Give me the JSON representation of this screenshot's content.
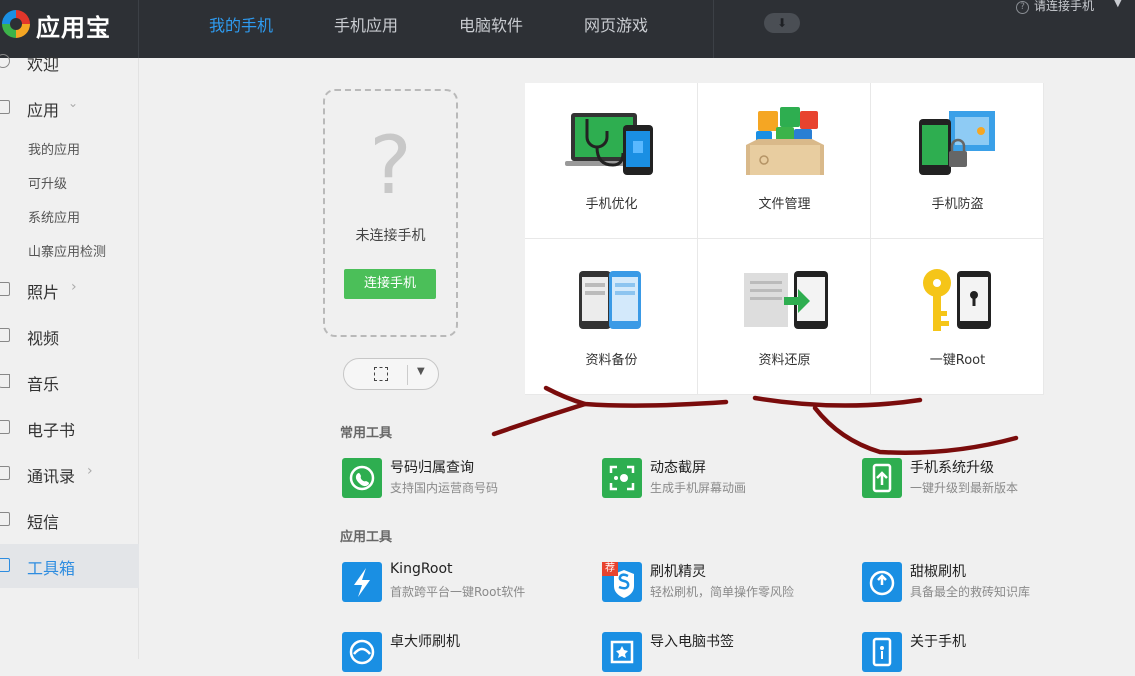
{
  "app": {
    "name": "应用宝"
  },
  "nav": {
    "tabs": [
      {
        "label": "我的手机",
        "active": true
      },
      {
        "label": "手机应用",
        "active": false
      },
      {
        "label": "电脑软件",
        "active": false
      },
      {
        "label": "网页游戏",
        "active": false
      }
    ],
    "download_icon": "download-icon",
    "connect_status": "请连接手机",
    "help_icon": "help-icon"
  },
  "sidebar": {
    "items": [
      {
        "label": "欢迎",
        "icon": "welcome-icon"
      },
      {
        "label": "应用",
        "icon": "grid-icon",
        "expanded": true
      },
      {
        "label": "照片",
        "icon": "photo-icon"
      },
      {
        "label": "视频",
        "icon": "video-icon"
      },
      {
        "label": "音乐",
        "icon": "music-icon"
      },
      {
        "label": "电子书",
        "icon": "book-icon"
      },
      {
        "label": "通讯录",
        "icon": "contacts-icon"
      },
      {
        "label": "短信",
        "icon": "sms-icon"
      },
      {
        "label": "工具箱",
        "icon": "toolbox-icon",
        "active": true
      }
    ],
    "sub_items": [
      "我的应用",
      "可升级",
      "系统应用",
      "山寨应用检测"
    ]
  },
  "phone_card": {
    "status": "未连接手机",
    "connect_button": "连接手机"
  },
  "feature_grid": [
    {
      "label": "手机优化",
      "icon": "phone-optimize-icon"
    },
    {
      "label": "文件管理",
      "icon": "file-manage-icon"
    },
    {
      "label": "手机防盗",
      "icon": "anti-theft-icon"
    },
    {
      "label": "资料备份",
      "icon": "backup-icon"
    },
    {
      "label": "资料还原",
      "icon": "restore-icon"
    },
    {
      "label": "一键Root",
      "icon": "root-key-icon"
    }
  ],
  "common_tools": {
    "title": "常用工具",
    "items": [
      {
        "name": "号码归属查询",
        "desc": "支持国内运营商号码",
        "icon": "phone-lookup-icon",
        "color": "#2eae50"
      },
      {
        "name": "动态截屏",
        "desc": "生成手机屏幕动画",
        "icon": "screen-capture-icon",
        "color": "#2eae50"
      },
      {
        "name": "手机系统升级",
        "desc": "一键升级到最新版本",
        "icon": "system-upgrade-icon",
        "color": "#2eae50"
      }
    ]
  },
  "app_tools": {
    "title": "应用工具",
    "items": [
      {
        "name": "KingRoot",
        "desc": "首款跨平台一键Root软件",
        "icon": "kingroot-icon",
        "color": "#1a8fe3"
      },
      {
        "name": "刷机精灵",
        "desc": "轻松刷机，简单操作零风险",
        "icon": "flash-wizard-icon",
        "color": "#1a8fe3",
        "badge": "荐"
      },
      {
        "name": "甜椒刷机",
        "desc": "具备最全的救砖知识库",
        "icon": "pepper-flash-icon",
        "color": "#1a8fe3"
      },
      {
        "name": "卓大师刷机",
        "desc": "",
        "icon": "master-flash-icon",
        "color": "#1a8fe3"
      },
      {
        "name": "导入电脑书签",
        "desc": "",
        "icon": "bookmark-import-icon",
        "color": "#1a8fe3"
      },
      {
        "name": "关于手机",
        "desc": "",
        "icon": "about-phone-icon",
        "color": "#1a8fe3"
      }
    ]
  },
  "annotation_color": "#7a0c0c"
}
